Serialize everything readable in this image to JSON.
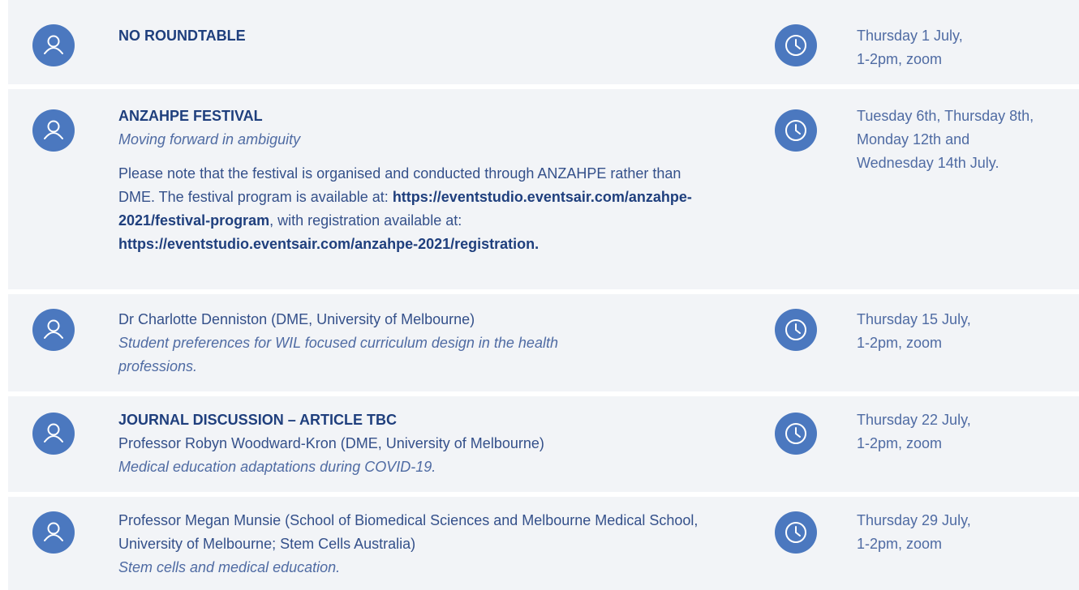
{
  "icons": {
    "person": "person-icon",
    "clock": "clock-icon",
    "accent_color": "#4b78bf",
    "row_background": "#f2f4f7"
  },
  "rows": [
    {
      "title": "NO ROUNDTABLE",
      "when": "Thursday 1 July,\n1-2pm, zoom"
    },
    {
      "title": "ANZAHPE FESTIVAL",
      "topic": "Moving forward in ambiguity",
      "note_part1": "Please note that the festival is organised and conducted through ANZAHPE rather than DME. The festival program is available at: ",
      "note_link1": "https://eventstudio.​eventsair.com/anzahpe-2021/festival-program",
      "note_part2": ", with registration available at: ",
      "note_link2": "https://eventstudio.eventsair.com/anzahpe-2021/registration.",
      "when": "Tuesday 6th, Thursday 8th,\nMonday 12th and\nWednesday 14th July."
    },
    {
      "speaker": "Dr Charlotte Denniston (DME, University of Melbourne)",
      "topic": "Student preferences for WIL focused curriculum design in the health professions.",
      "when": "Thursday 15 July,\n1-2pm, zoom"
    },
    {
      "title": "JOURNAL DISCUSSION – ARTICLE TBC",
      "speaker": "Professor Robyn Woodward-Kron (DME, University of Melbourne)",
      "topic": "Medical education adaptations during COVID-19.",
      "when": "Thursday 22 July,\n1-2pm, zoom"
    },
    {
      "speaker": "Professor Megan Munsie (School of Biomedical Sciences and Melbourne Medical School, University of Melbourne; Stem Cells Australia)",
      "topic": "Stem cells and medical education.",
      "when": "Thursday 29 July,\n1-2pm, zoom"
    }
  ]
}
